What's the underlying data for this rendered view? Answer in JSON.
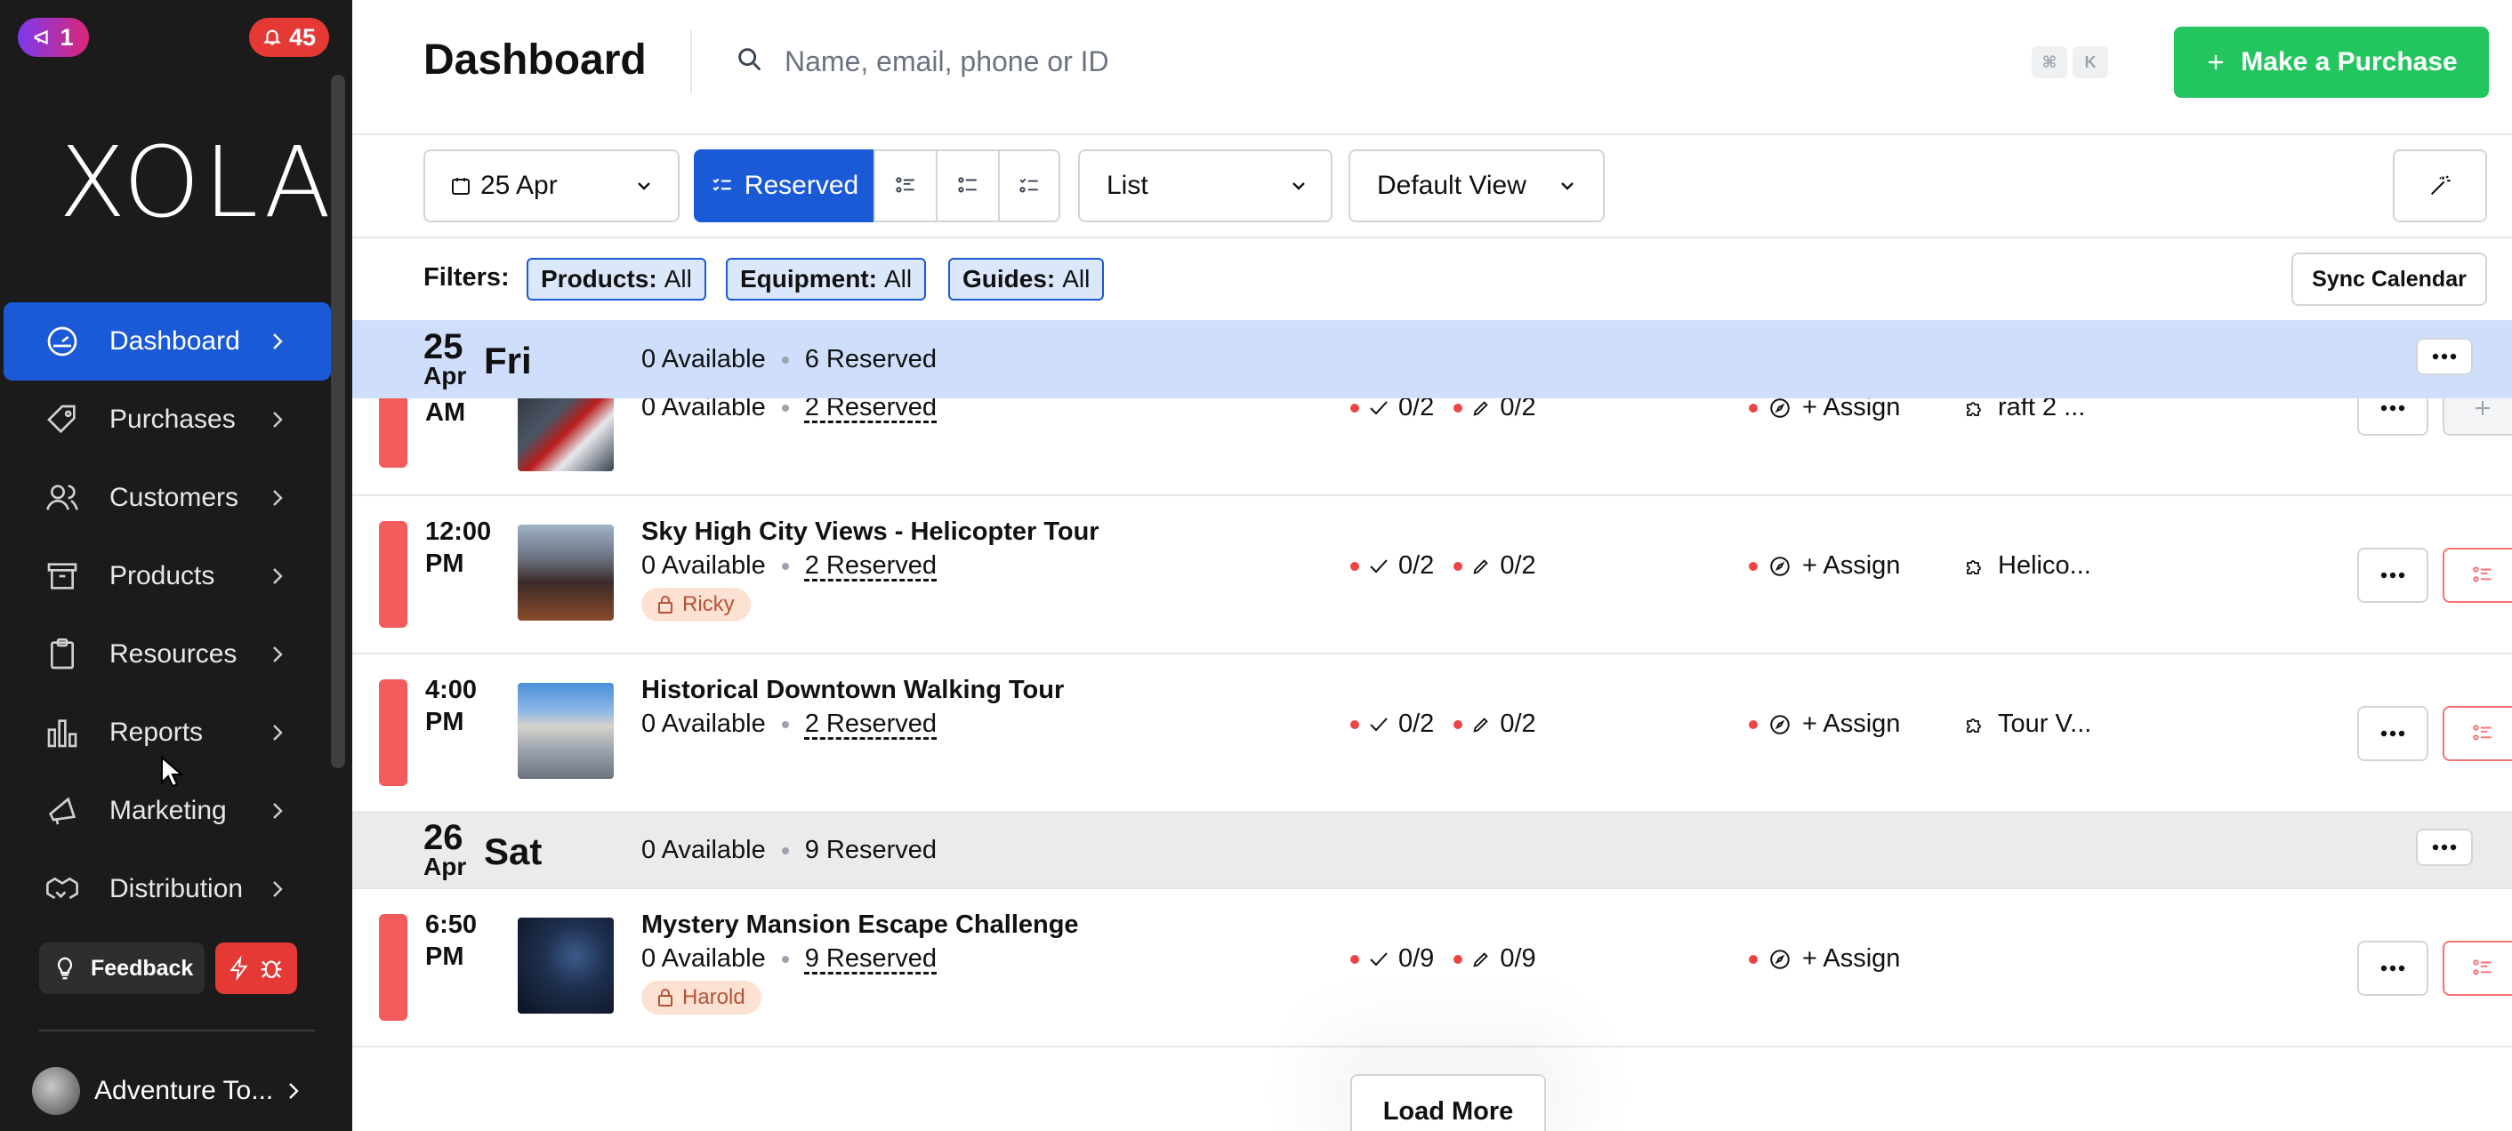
{
  "sidebar": {
    "promo_badge": "1",
    "notification_count": "45",
    "logo": "XOLA",
    "items": [
      {
        "label": "Dashboard",
        "icon": "speedometer-icon",
        "active": true
      },
      {
        "label": "Purchases",
        "icon": "tag-icon"
      },
      {
        "label": "Customers",
        "icon": "users-icon"
      },
      {
        "label": "Products",
        "icon": "archive-box-icon"
      },
      {
        "label": "Resources",
        "icon": "clipboard-icon"
      },
      {
        "label": "Reports",
        "icon": "bar-chart-icon"
      },
      {
        "label": "Marketing",
        "icon": "megaphone-icon"
      },
      {
        "label": "Distribution",
        "icon": "handshake-icon"
      }
    ],
    "feedback_label": "Feedback",
    "account_name": "Adventure To..."
  },
  "header": {
    "title": "Dashboard",
    "search_placeholder": "Name, email, phone or ID",
    "shortcut_keys": [
      "⌘",
      "K"
    ],
    "purchase_button": "Make a Purchase"
  },
  "toolbar": {
    "date": "25 Apr",
    "reserved_label": "Reserved",
    "view_mode": "List",
    "saved_view": "Default View"
  },
  "filters": {
    "label": "Filters:",
    "chips": [
      {
        "name": "Products:",
        "value": "All"
      },
      {
        "name": "Equipment:",
        "value": "All"
      },
      {
        "name": "Guides:",
        "value": "All"
      }
    ],
    "sync_label": "Sync Calendar"
  },
  "days": [
    {
      "day": "25",
      "month": "Apr",
      "weekday": "Fri",
      "available": "0 Available",
      "reserved": "6 Reserved",
      "highlighted": true,
      "events": [
        {
          "time_1": "",
          "time_2": "AM",
          "title": "",
          "available": "0 Available",
          "reserved": "2 Reserved",
          "guide": "",
          "checked": "0/2",
          "signed": "0/2",
          "assign": "+ Assign",
          "resource": "raft 2 ...",
          "thumb": "raft"
        },
        {
          "time_1": "12:00",
          "time_2": "PM",
          "title": "Sky High City Views - Helicopter Tour",
          "available": "0 Available",
          "reserved": "2 Reserved",
          "guide": "Ricky",
          "checked": "0/2",
          "signed": "0/2",
          "assign": "+ Assign",
          "resource": "Helico...",
          "thumb": "city"
        },
        {
          "time_1": "4:00",
          "time_2": "PM",
          "title": "Historical Downtown Walking Tour",
          "available": "0 Available",
          "reserved": "2 Reserved",
          "guide": "",
          "checked": "0/2",
          "signed": "0/2",
          "assign": "+ Assign",
          "resource": "Tour V...",
          "thumb": "building"
        }
      ]
    },
    {
      "day": "26",
      "month": "Apr",
      "weekday": "Sat",
      "available": "0 Available",
      "reserved": "9 Reserved",
      "highlighted": false,
      "events": [
        {
          "time_1": "6:50",
          "time_2": "PM",
          "title": "Mystery Mansion Escape Challenge",
          "available": "0 Available",
          "reserved": "9 Reserved",
          "guide": "Harold",
          "checked": "0/9",
          "signed": "0/9",
          "assign": "+ Assign",
          "resource": "",
          "thumb": "mansion"
        }
      ]
    }
  ],
  "load_more": "Load More",
  "colors": {
    "primary": "#1a5ad7",
    "success": "#22c55e",
    "danger": "#ef4444",
    "day_highlight": "#cfdffb",
    "day_default": "#ebebeb",
    "sidebar_bg": "#1b1b1b"
  }
}
